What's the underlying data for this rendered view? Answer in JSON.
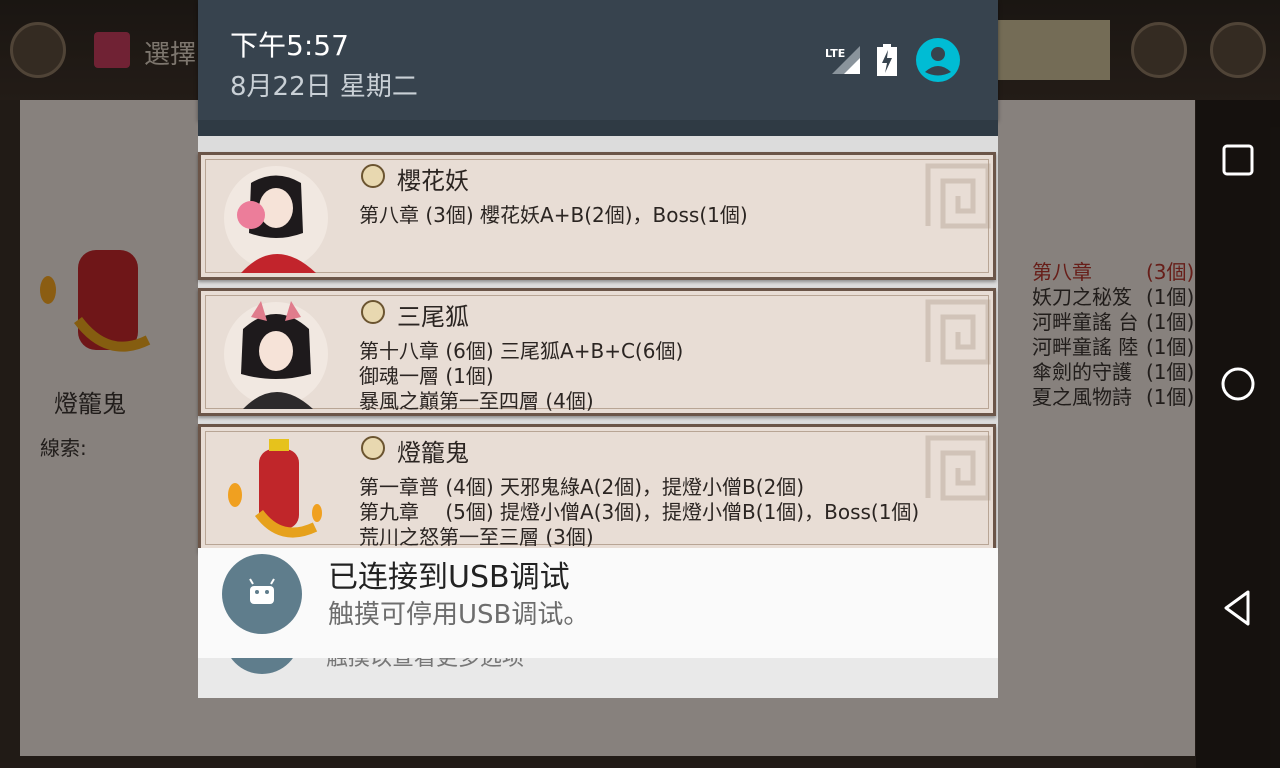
{
  "status_bar": {
    "time": "下午5:57",
    "date": "8月22日 星期二",
    "network_label": "LTE",
    "icons": [
      "lte-signal-icon",
      "battery-charging-icon",
      "account-icon"
    ]
  },
  "notifications": [
    {
      "title": "櫻花妖",
      "lines": [
        "第八章 (3個) 櫻花妖A+B(2個)，Boss(1個)"
      ]
    },
    {
      "title": "三尾狐",
      "lines": [
        "第十八章 (6個) 三尾狐A+B+C(6個)",
        "御魂一層 (1個)",
        "暴風之巔第一至四層 (4個)"
      ]
    },
    {
      "title": "燈籠鬼",
      "lines": [
        "第一章普 (4個) 天邪鬼綠A(2個)，提燈小僧B(2個)",
        "第九章　 (5個) 提燈小僧A(3個)，提燈小僧B(1個)，Boss(1個)",
        "荒川之怒第一至三層 (3個)"
      ]
    }
  ],
  "usb": {
    "title": "已连接到USB调试",
    "text": "触摸可停用USB调试。",
    "hidden_text": "触摸以查看更多选项"
  },
  "background_app": {
    "select_label": "選擇",
    "monster_name": "燈籠鬼",
    "clue_label": "線索:",
    "right_list": [
      {
        "name": "第八章",
        "count": "(3個)"
      },
      {
        "name": "妖刀之秘笈",
        "count": "(1個)"
      },
      {
        "name": "河畔童謠 台",
        "count": "(1個)"
      },
      {
        "name": "河畔童謠 陸",
        "count": "(1個)"
      },
      {
        "name": "傘劍的守護",
        "count": "(1個)"
      },
      {
        "name": "夏之風物詩",
        "count": "(1個)"
      }
    ]
  },
  "nav": {
    "recents": "recents-icon",
    "home": "home-icon",
    "back": "back-icon"
  },
  "colors": {
    "shade_header": "#37434e",
    "card_bg": "#e8ddd5",
    "card_border": "#6b5548",
    "accent_cyan": "#00bcd4",
    "usb_icon": "#5f7d8c"
  }
}
